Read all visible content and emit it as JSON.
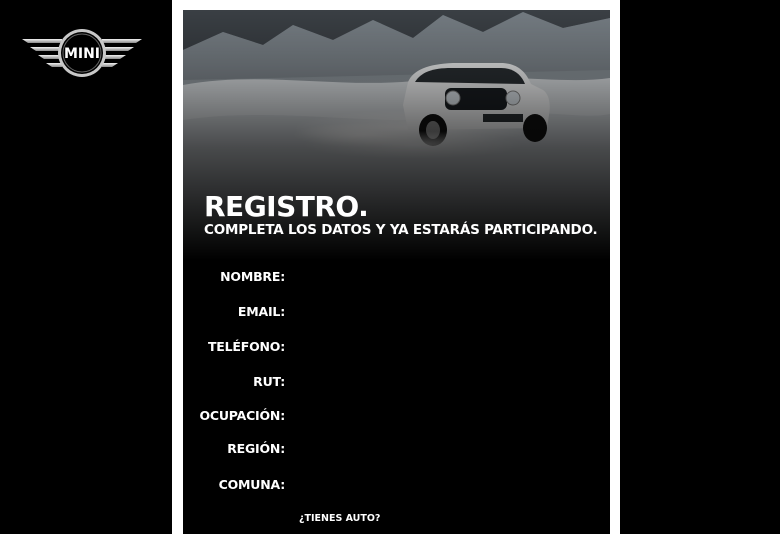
{
  "brand": {
    "logo_text": "MINI"
  },
  "page": {
    "title": "REGISTRO.",
    "subtitle": "COMPLETA LOS DATOS Y YA ESTARÁS PARTICIPANDO."
  },
  "form": {
    "fields": [
      {
        "key": "nombre",
        "label": "NOMBRE:",
        "value": ""
      },
      {
        "key": "email",
        "label": "EMAIL:",
        "value": ""
      },
      {
        "key": "telefono",
        "label": "TELÉFONO:",
        "value": ""
      },
      {
        "key": "rut",
        "label": "RUT:",
        "value": ""
      },
      {
        "key": "ocupacion",
        "label": "OCUPACIÓN:",
        "value": ""
      },
      {
        "key": "region",
        "label": "REGIÓN:",
        "value": ""
      },
      {
        "key": "comuna",
        "label": "COMUNA:",
        "value": ""
      }
    ],
    "question": "¿TIENES AUTO?"
  }
}
